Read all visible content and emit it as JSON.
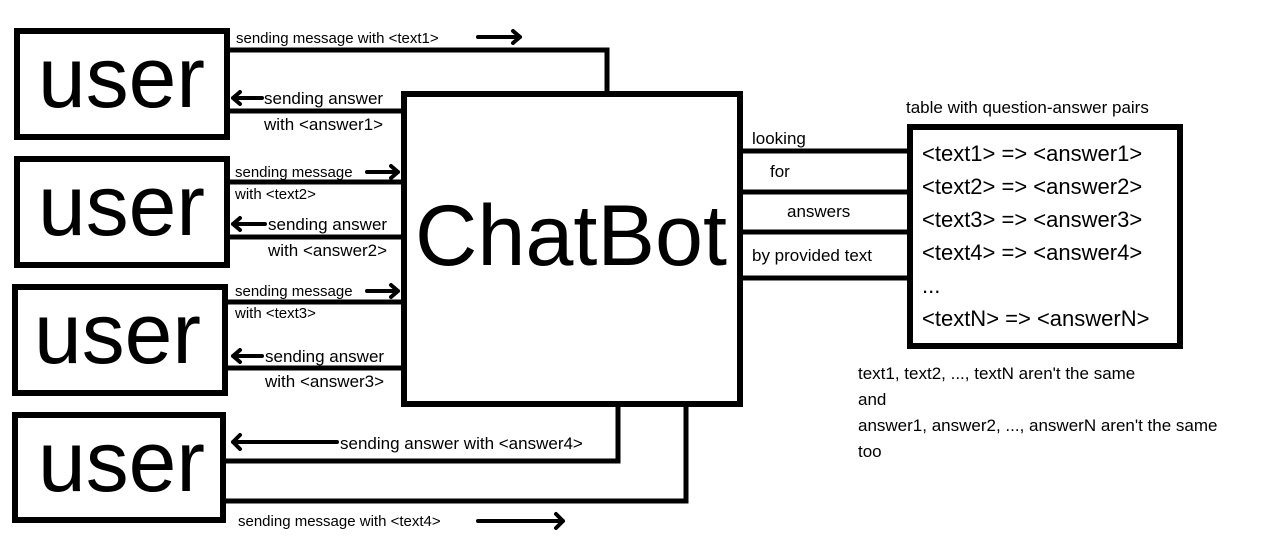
{
  "users": [
    {
      "label": "user",
      "send": [
        "sending message with <text1>"
      ],
      "answer": [
        "sending answer",
        "with <answer1>"
      ]
    },
    {
      "label": "user",
      "send": [
        "sending message",
        "with <text2>"
      ],
      "answer": [
        "sending answer",
        "with <answer2>"
      ]
    },
    {
      "label": "user",
      "send": [
        "sending message",
        "with <text3>"
      ],
      "answer": [
        "sending answer",
        "with <answer3>"
      ]
    },
    {
      "label": "user",
      "send": [
        "sending message with <text4>"
      ],
      "answer": [
        "sending answer with <answer4>"
      ]
    }
  ],
  "chatbot": {
    "label": "ChatBot"
  },
  "lookup": [
    "looking",
    "for",
    "answers",
    "by provided text"
  ],
  "table": {
    "title": "table with question-answer pairs",
    "rows": [
      "<text1> => <answer1>",
      "<text2> => <answer2>",
      "<text3> => <answer3>",
      "<text4> => <answer4>",
      "...",
      "<textN> => <answerN>"
    ]
  },
  "note": [
    "text1, text2, ..., textN aren't the same",
    "and",
    "answer1, answer2, ..., answerN aren't the same",
    "too"
  ]
}
